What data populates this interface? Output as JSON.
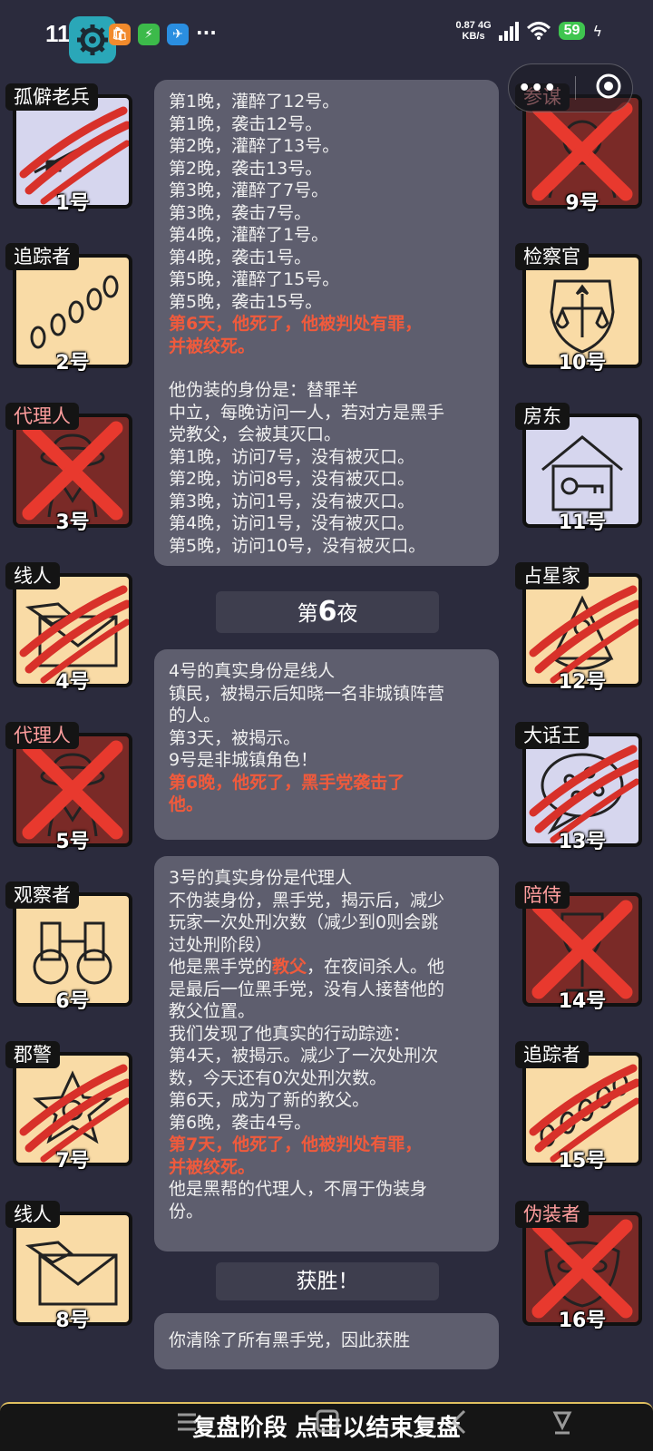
{
  "status_bar": {
    "time": "11:09",
    "net_speed_value": "0.87",
    "net_speed_unit": "KB/s",
    "network_type": "4G",
    "battery": "59"
  },
  "players_left": [
    {
      "role": "孤僻老兵",
      "number": "1号",
      "state": "clawed",
      "bg": "lavender",
      "icon": "rifle-icon"
    },
    {
      "role": "追踪者",
      "number": "2号",
      "state": "alive",
      "bg": "sand",
      "icon": "footprints-icon"
    },
    {
      "role": "代理人",
      "number": "3号",
      "state": "executed",
      "bg": "darkred",
      "icon": "spy-icon"
    },
    {
      "role": "线人",
      "number": "4号",
      "state": "clawed",
      "bg": "sand",
      "icon": "envelope-icon"
    },
    {
      "role": "代理人",
      "number": "5号",
      "state": "executed",
      "bg": "darkred",
      "icon": "spy-icon"
    },
    {
      "role": "观察者",
      "number": "6号",
      "state": "alive",
      "bg": "sand",
      "icon": "binoculars-icon"
    },
    {
      "role": "郡警",
      "number": "7号",
      "state": "clawed",
      "bg": "sand",
      "icon": "sheriff-badge-icon"
    },
    {
      "role": "线人",
      "number": "8号",
      "state": "alive",
      "bg": "sand",
      "icon": "envelope-icon"
    }
  ],
  "players_right": [
    {
      "role": "参谋",
      "number": "9号",
      "state": "executed",
      "bg": "darkred",
      "icon": "consigliere-icon"
    },
    {
      "role": "检察官",
      "number": "10号",
      "state": "alive",
      "bg": "sand",
      "icon": "justice-badge-icon"
    },
    {
      "role": "房东",
      "number": "11号",
      "state": "alive",
      "bg": "lavender",
      "icon": "house-key-icon"
    },
    {
      "role": "占星家",
      "number": "12号",
      "state": "clawed",
      "bg": "sand",
      "icon": "sextant-icon"
    },
    {
      "role": "大话王",
      "number": "13号",
      "state": "clawed",
      "bg": "lavender",
      "icon": "speech-bubble-icon"
    },
    {
      "role": "陪侍",
      "number": "14号",
      "state": "executed",
      "bg": "darkred",
      "icon": "wine-glass-icon"
    },
    {
      "role": "追踪者",
      "number": "15号",
      "state": "clawed",
      "bg": "sand",
      "icon": "footprints-icon"
    },
    {
      "role": "伪装者",
      "number": "16号",
      "state": "executed",
      "bg": "darkred",
      "icon": "mask-icon"
    }
  ],
  "log1": {
    "lines": [
      "第1晚，灌醉了12号。",
      "第1晚，袭击12号。",
      "第2晚，灌醉了13号。",
      "第2晚，袭击13号。",
      "第3晚，灌醉了7号。",
      "第3晚，袭击7号。",
      "第4晚，灌醉了1号。",
      "第4晚，袭击1号。",
      "第5晚，灌醉了15号。",
      "第5晚，袭击15号。"
    ],
    "death_1": "第6天，他死了，他被判处有罪，",
    "death_2": "并被绞死。",
    "disguise": "他伪装的身份是：替罪羊",
    "desc_1": "中立，每晚访问一人，若对方是黑手",
    "desc_2": "党教父，会被其灭口。",
    "visits": [
      "第1晚，访问7号，没有被灭口。",
      "第2晚，访问8号，没有被灭口。",
      "第3晚，访问1号，没有被灭口。",
      "第4晚，访问1号，没有被灭口。",
      "第5晚，访问10号，没有被灭口。"
    ]
  },
  "night_header_pre": "第",
  "night_header_num": "6",
  "night_header_post": "夜",
  "log2": {
    "lines": [
      "4号的真实身份是线人",
      "镇民，被揭示后知晓一名非城镇阵营",
      "的人。",
      "第3天，被揭示。",
      "9号是非城镇角色！"
    ],
    "death_1": "第6晚，他死了，黑手党袭击了",
    "death_2": "他。"
  },
  "log3": {
    "l1": "3号的真实身份是代理人",
    "l2": "不伪装身份，黑手党，揭示后，减少",
    "l3": "玩家一次处刑次数（减少到0则会跳",
    "l4": "过处刑阶段）",
    "l5_pre": "他是黑手党的",
    "l5_hl": "教父",
    "l5_post": "，在夜间杀人。他",
    "l6": "是最后一位黑手党，没有人接替他的",
    "l7": "教父位置。",
    "l8": "我们发现了他真实的行动踪迹：",
    "l9": "第4天，被揭示。减少了一次处刑次",
    "l10": "数，今天还有0次处刑次数。",
    "l11": "第6天，成为了新的教父。",
    "l12": "第6晚，袭击4号。",
    "death_1": "第7天，他死了，他被判处有罪，",
    "death_2": "并被绞死。",
    "l13": "他是黑帮的代理人，不屑于伪装身",
    "l14": "份。"
  },
  "victory_header": "获胜！",
  "victory_text": "你清除了所有黑手党，因此获胜",
  "bottom_bar": "复盘阶段 点击以结束复盘"
}
